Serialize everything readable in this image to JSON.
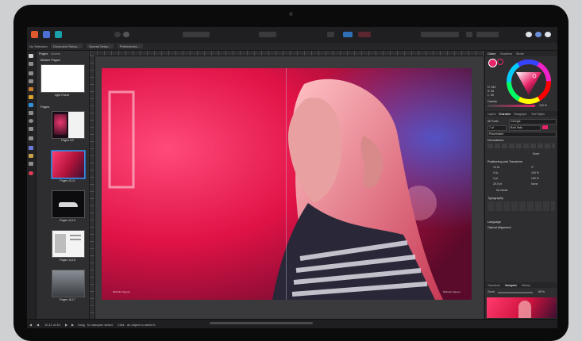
{
  "context_bar": {
    "selection": "No Selection",
    "document_setup": "Document Setup...",
    "spread_setup": "Spread Setup...",
    "preferences": "Preferences..."
  },
  "pages_panel": {
    "tabs": [
      "Pages",
      "Assets"
    ],
    "master_header": "Master Pages",
    "pages_header": "Pages",
    "thumbnails": [
      {
        "label": "Light Frame"
      },
      {
        "label": "Pages 8,9"
      },
      {
        "label": "Pages 10,11"
      },
      {
        "label": "Pages 12,13"
      },
      {
        "label": "Pages 14,15"
      },
      {
        "label": "Pages 16,17"
      }
    ]
  },
  "canvas": {
    "credit_left": "Michelle Nguyen",
    "credit_right": "Michelle Nguyen"
  },
  "right_panel": {
    "color_tabs": [
      "Colour",
      "Swatches",
      "Stroke"
    ],
    "hsl": {
      "h_label": "H: 343",
      "s_label": "S: 96",
      "l_label": "L: 56"
    },
    "opacity_label": "Opacity",
    "opacity_value": "100 %",
    "type_tabs": [
      "Layers",
      "Character",
      "Paragraph",
      "Text Styles"
    ],
    "font_scope": "All Fonts",
    "font_family": "Georgia",
    "font_size": "7 pt",
    "font_style": "Bold Italic",
    "style_placeholder": "Placeholder",
    "decorations_header": "Decorations",
    "none_label": "None",
    "positioning_header": "Positioning and Transform",
    "pos_values": [
      "12 ‰",
      "0 ‰",
      "0 pt",
      "20.0 pt",
      "0 °",
      "100 %",
      "100 %",
      "None"
    ],
    "no_break": "No break",
    "typography_header": "Typography",
    "language_header": "Language",
    "optical_header": "Optical Alignment",
    "nav_tabs": [
      "Transform",
      "Navigator",
      "History"
    ],
    "zoom_label": "Zoom",
    "zoom_value": "68 %"
  },
  "status_bar": {
    "page_indicator": "10,11 of 40",
    "hint_drag": "Drag",
    "hint_text1": "to marquee select.",
    "hint_click": "Click",
    "hint_text2": "an object to select it."
  },
  "colors": {
    "accent": "#3d8ee6",
    "active_color": "#e8246a",
    "publisher_icon": "#d4432b"
  }
}
